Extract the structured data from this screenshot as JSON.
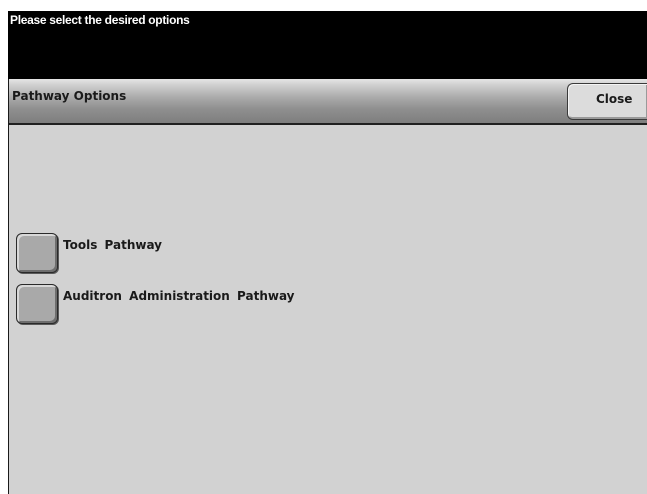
{
  "message_bar": {
    "text": "Please select the desired options"
  },
  "header": {
    "title": "Pathway  Options",
    "close_label": "Close"
  },
  "options": [
    {
      "label": "Tools  Pathway"
    },
    {
      "label": "Auditron  Administration  Pathway"
    }
  ],
  "colors": {
    "message_bar_bg": "#000000",
    "message_text": "#ffffff",
    "panel_bg": "#d2d2d2",
    "header_bg": "#8f8f8f",
    "option_button": "#a9a9a9"
  }
}
